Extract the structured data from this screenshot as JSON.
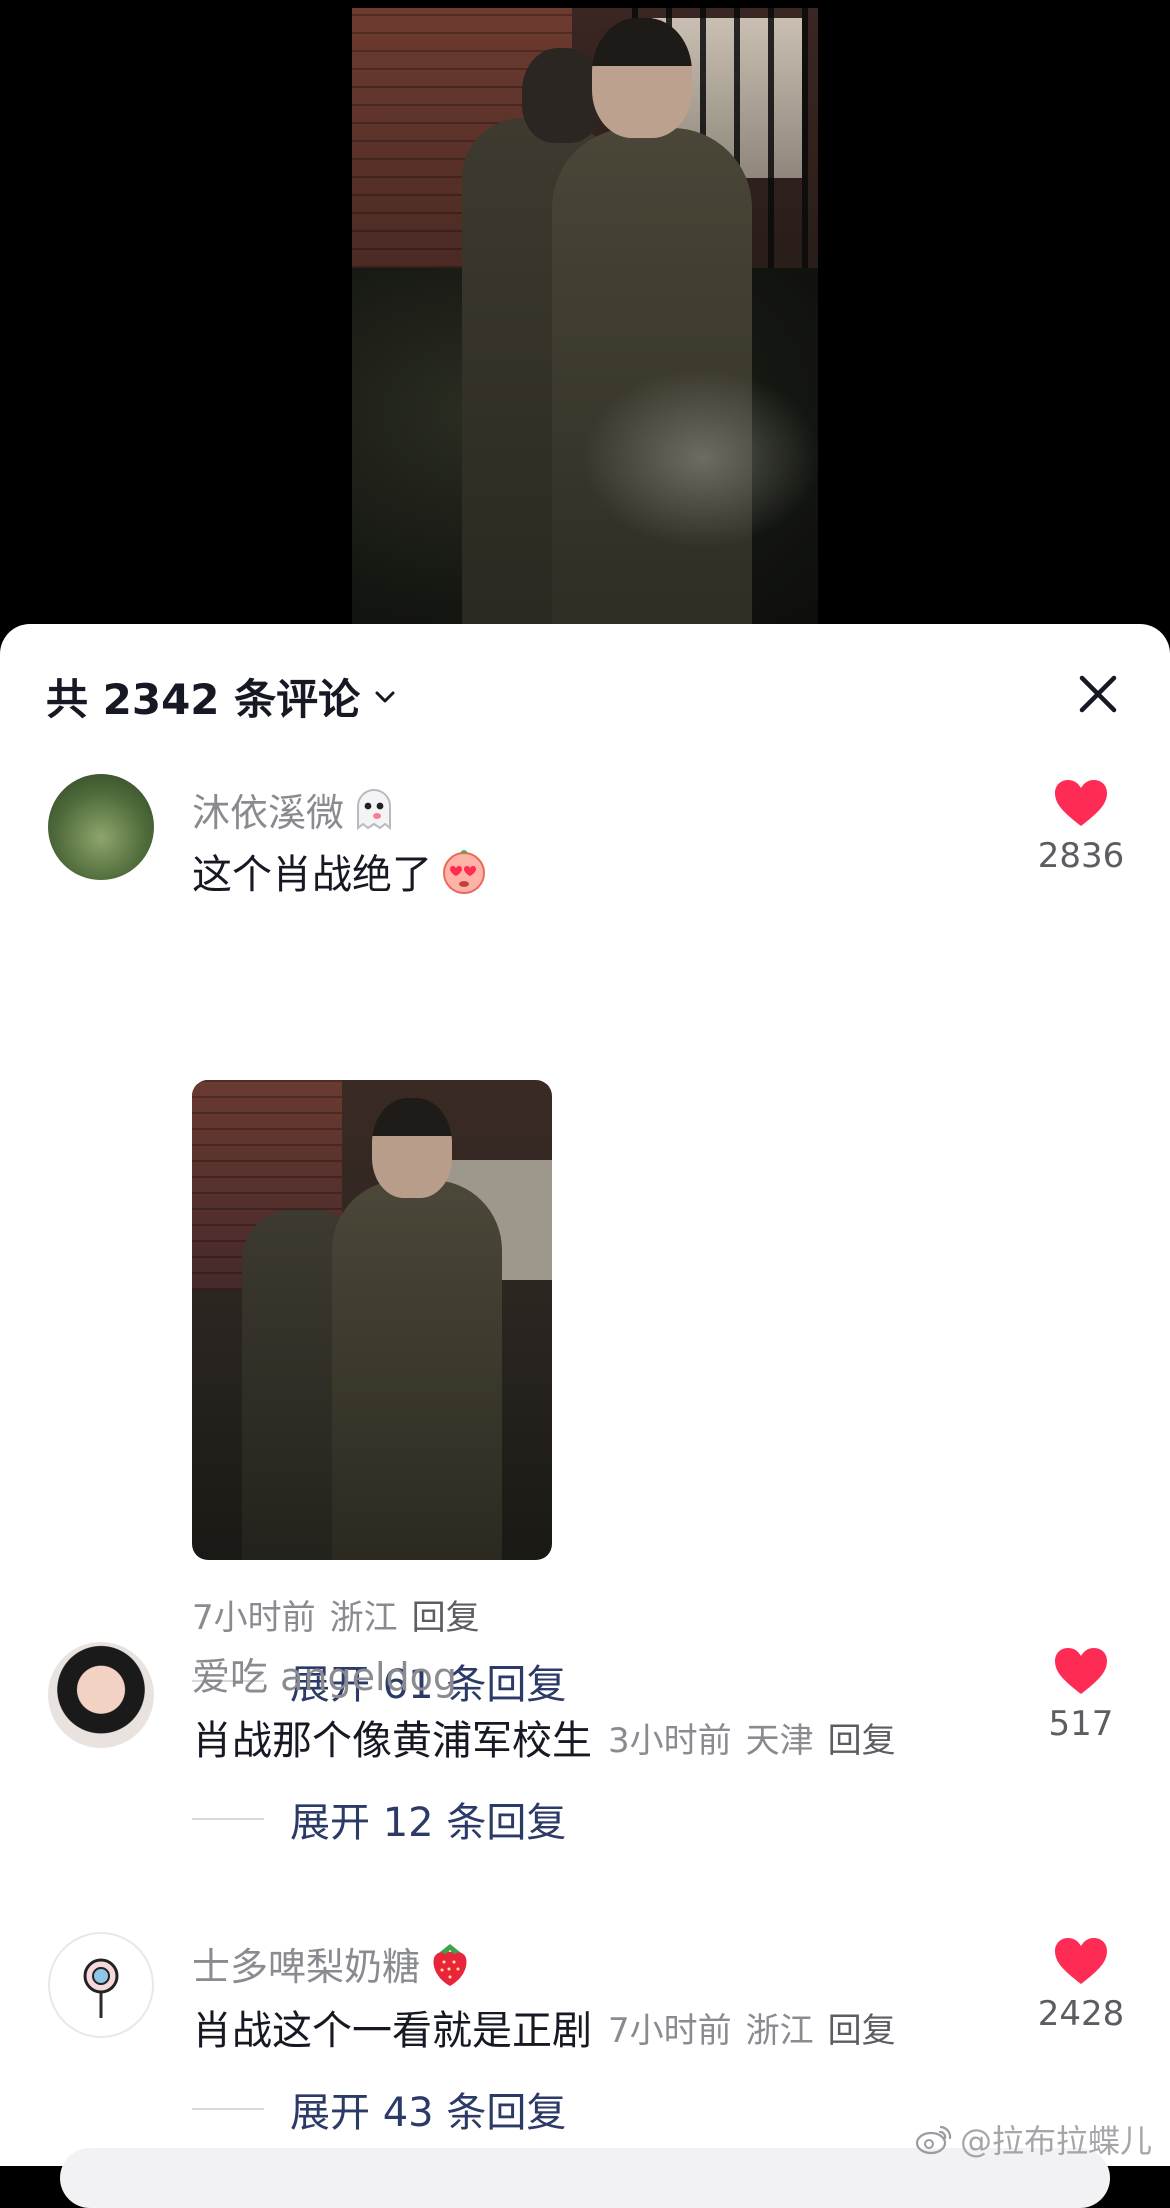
{
  "header": {
    "comment_count_label": "共 2342 条评论"
  },
  "comments": [
    {
      "username": "沐依溪微",
      "text": "这个肖战绝了",
      "time": "7小时前",
      "location": "浙江",
      "reply_label": "回复",
      "likes": "2836",
      "expand_label": "展开 61 条回复"
    },
    {
      "username": "爱吃 angeldog",
      "text": "肖战那个像黄浦军校生",
      "time": "3小时前",
      "location": "天津",
      "reply_label": "回复",
      "likes": "517",
      "expand_label": "展开 12 条回复"
    },
    {
      "username": "士多啤梨奶糖",
      "text": "肖战这个一看就是正剧",
      "time": "7小时前",
      "location": "浙江",
      "reply_label": "回复",
      "likes": "2428",
      "expand_label": "展开 43 条回复"
    }
  ],
  "watermark": "@拉布拉蝶儿",
  "colors": {
    "heart": "#fe2c55",
    "expand_link": "#2b3a67",
    "secondary_text": "#8a8b91"
  }
}
